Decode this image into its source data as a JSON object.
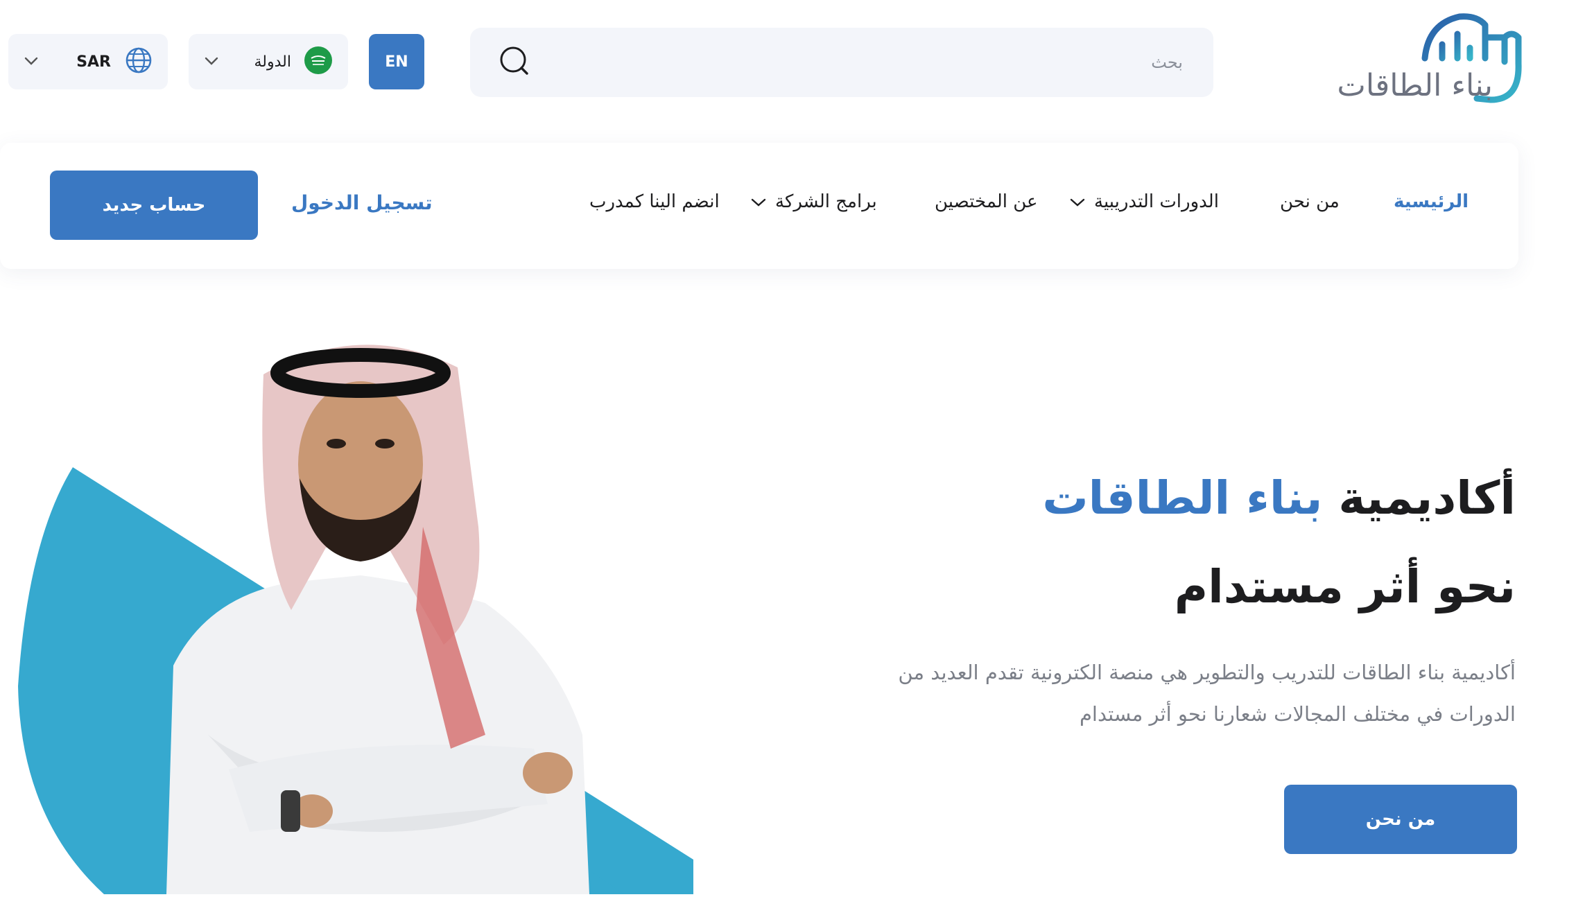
{
  "topbar": {
    "currency": "SAR",
    "country_label": "الدولة",
    "language_button": "EN",
    "search_placeholder": "بحث"
  },
  "logo": {
    "name": "بناء الطاقات"
  },
  "nav": {
    "items": [
      {
        "label": "الرئيسية"
      },
      {
        "label": "من نحن"
      },
      {
        "label": "الدورات التدريبية"
      },
      {
        "label": "عن المختصين"
      },
      {
        "label": "برامج الشركة"
      },
      {
        "label": "انضم الينا كمدرب"
      }
    ],
    "login": "تسجيل الدخول",
    "signup": "حساب جديد"
  },
  "hero": {
    "title_prefix": "أكاديمية",
    "title_accent": "بناء الطاقات",
    "subtitle": "نحو أثر مستدام",
    "description": "أكاديمية بناء الطاقات للتدريب والتطوير هي منصة الكترونية تقدم العديد من الدورات في مختلف المجالات شعارنا نحو أثر مستدام",
    "cta": "من نحن"
  },
  "colors": {
    "brand_blue": "#3a78c2",
    "accent_teal": "#36a9cf",
    "muted_text": "#7b7f88",
    "pill_bg": "#f3f5fa"
  }
}
